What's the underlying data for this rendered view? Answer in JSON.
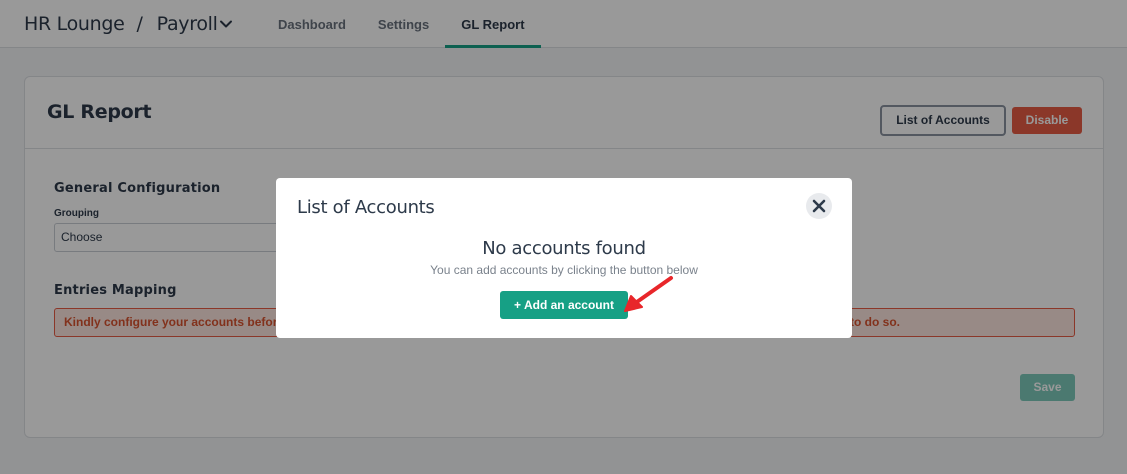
{
  "header": {
    "company": "HR Lounge",
    "separator": "/",
    "module": "Payroll",
    "tabs": [
      {
        "label": "Dashboard",
        "active": false
      },
      {
        "label": "Settings",
        "active": false
      },
      {
        "label": "GL Report",
        "active": true
      }
    ]
  },
  "card": {
    "title": "GL Report",
    "list_accounts_label": "List of Accounts",
    "disable_label": "Disable",
    "general_config_title": "General Configuration",
    "grouping_label": "Grouping",
    "grouping_value": "Choose",
    "entries_mapping_title": "Entries Mapping",
    "alert_text_left": "Kindly configure your accounts befor",
    "alert_text_right": "to do so.",
    "save_label": "Save"
  },
  "modal": {
    "title": "List of Accounts",
    "empty_title": "No accounts found",
    "empty_subtitle": "You can add accounts by clicking the button below",
    "add_button_label": "+ Add an account"
  },
  "colors": {
    "accent": "#16a085",
    "danger": "#e85c45",
    "annotation_arrow": "#e8262a"
  }
}
